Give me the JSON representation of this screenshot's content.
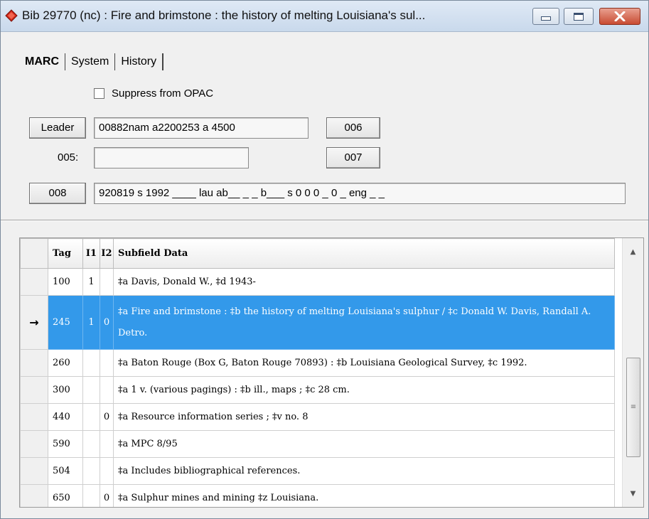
{
  "window": {
    "title": "Bib 29770 (nc) : Fire and brimstone : the history of melting Louisiana's sul...",
    "icon": "diamond-record-icon"
  },
  "tabs": [
    {
      "label": "MARC",
      "active": true
    },
    {
      "label": "System",
      "active": false
    },
    {
      "label": "History",
      "active": false
    }
  ],
  "suppress": {
    "label": "Suppress from OPAC",
    "checked": false
  },
  "leader": {
    "button": "Leader",
    "value": "00882nam a2200253 a 4500"
  },
  "f005": {
    "label": "005:",
    "value": ""
  },
  "f006": {
    "button": "006"
  },
  "f007": {
    "button": "007"
  },
  "f008": {
    "button": "008",
    "value": "920819 s 1992 ____ lau ab__ _ _ b___ s 0 0 0 _ 0 _ eng _ _"
  },
  "grid": {
    "headers": [
      "Tag",
      "I1",
      "I2",
      "Subfield Data"
    ],
    "rows": [
      {
        "tag": "100",
        "i1": "1",
        "i2": "",
        "data": "‡a Davis, Donald W., ‡d 1943-"
      },
      {
        "tag": "245",
        "i1": "1",
        "i2": "0",
        "data": "‡a Fire and brimstone : ‡b the history of melting Louisiana's sulphur / ‡c Donald W. Davis, Randall A. Detro.",
        "selected": true,
        "indicator": "→"
      },
      {
        "tag": "260",
        "i1": "",
        "i2": "",
        "data": "‡a Baton Rouge (Box G, Baton Rouge 70893) : ‡b Louisiana Geological Survey, ‡c 1992."
      },
      {
        "tag": "300",
        "i1": "",
        "i2": "",
        "data": "‡a 1 v. (various pagings) : ‡b ill., maps ; ‡c 28 cm."
      },
      {
        "tag": "440",
        "i1": "",
        "i2": "0",
        "data": "‡a Resource information series ; ‡v no. 8"
      },
      {
        "tag": "590",
        "i1": "",
        "i2": "",
        "data": "‡a MPC 8/95"
      },
      {
        "tag": "504",
        "i1": "",
        "i2": "",
        "data": "‡a Includes bibliographical references."
      },
      {
        "tag": "650",
        "i1": "",
        "i2": "0",
        "data": "‡a Sulphur mines and mining ‡z Louisiana."
      }
    ]
  },
  "colors": {
    "selection": "#3399ea",
    "close_button": "#c84b32"
  }
}
